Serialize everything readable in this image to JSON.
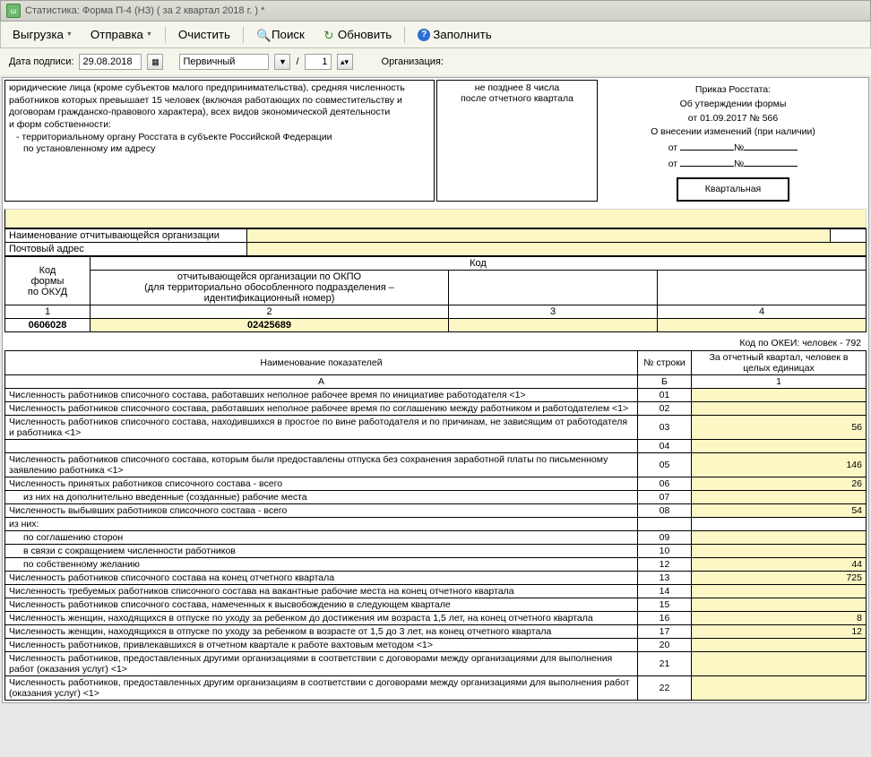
{
  "window": {
    "title": "Статистика: Форма П-4 (НЗ) ( за 2 квартал 2018 г. ) *"
  },
  "toolbar": {
    "export": "Выгрузка",
    "send": "Отправка",
    "clear": "Очистить",
    "search": "Поиск",
    "refresh": "Обновить",
    "fill": "Заполнить"
  },
  "params": {
    "date_label": "Дата подписи:",
    "date_value": "29.08.2018",
    "type_value": "Первичный",
    "slash": "/",
    "num_value": "1",
    "org_label": "Организация:"
  },
  "header": {
    "left_l1": "юридические лица (кроме субъектов малого предпринимательства), средняя численность",
    "left_l2": "работников которых превышает 15 человек (включая работающих по совместительству и",
    "left_l3": "договорам гражданско-правового характера), всех видов экономической деятельности",
    "left_l4": "и форм собственности:",
    "left_l5": "- территориальному органу Росстата в субъекте Российской Федерации",
    "left_l6": "по установленному им адресу",
    "mid_l1": "не позднее 8 числа",
    "mid_l2": "после отчетного квартала",
    "right_l1": "Приказ Росстата:",
    "right_l2": "Об утверждении формы",
    "right_l3": "от 01.09.2017 № 566",
    "right_l4": "О внесении изменений (при наличии)",
    "right_ot": "от",
    "right_no": "№",
    "badge": "Квартальная"
  },
  "org": {
    "name_label": "Наименование отчитывающейся организации",
    "addr_label": "Почтовый адрес"
  },
  "codes": {
    "col1_l1": "Код",
    "col1_l2": "формы",
    "col1_l3": "по ОКУД",
    "col_code": "Код",
    "col2_l1": "отчитывающейся организации по ОКПО",
    "col2_l2": "(для территориально обособленного подразделения –",
    "col2_l3": "идентификационный номер)",
    "h1": "1",
    "h2": "2",
    "h3": "3",
    "h4": "4",
    "v1": "0606028",
    "v2": "02425689"
  },
  "note": "Код по ОКЕИ: человек - 792",
  "dtable": {
    "col_a": "Наименование показателей",
    "col_b": "№ строки",
    "col_1": "За отчетный квартал, человек в целых единицах",
    "ha": "А",
    "hb": "Б",
    "h1": "1",
    "rows": [
      {
        "name": "Численность работников списочного состава, работавших неполное рабочее время по инициативе работодателя <1>",
        "num": "01",
        "val": ""
      },
      {
        "name": "Численность работников списочного состава, работавших неполное рабочее время по соглашению между работником и работодателем <1>",
        "num": "02",
        "val": ""
      },
      {
        "name": "Численность работников списочного состава, находившихся в простое по вине работодателя и по причинам, не зависящим от работодателя и работника <1>",
        "num": "03",
        "val": "56"
      },
      {
        "name": "",
        "num": "04",
        "val": ""
      },
      {
        "name": "Численность работников списочного состава, которым были предоставлены отпуска без сохранения заработной платы по письменному заявлению работника <1>",
        "num": "05",
        "val": "146"
      },
      {
        "name": "Численность принятых работников списочного состава - всего",
        "num": "06",
        "val": "26"
      },
      {
        "name": "из них на дополнительно введенные (созданные) рабочие места",
        "num": "07",
        "val": "",
        "ind": "ind2"
      },
      {
        "name": "Численность выбывших работников списочного состава - всего",
        "num": "08",
        "val": "54"
      },
      {
        "name": "из них:",
        "num": "",
        "val": "",
        "noval": true
      },
      {
        "name": "по соглашению сторон",
        "num": "09",
        "val": "",
        "ind": "ind2"
      },
      {
        "name": "в связи с сокращением численности работников",
        "num": "10",
        "val": "",
        "ind": "ind2"
      },
      {
        "name": "по собственному желанию",
        "num": "12",
        "val": "44",
        "ind": "ind2"
      },
      {
        "name": "Численность работников списочного состава на конец отчетного квартала",
        "num": "13",
        "val": "725"
      },
      {
        "name": "Численность требуемых работников списочного состава на вакантные рабочие места на конец отчетного квартала",
        "num": "14",
        "val": ""
      },
      {
        "name": "Численность работников списочного состава, намеченных к высвобождению в следующем квартале",
        "num": "15",
        "val": ""
      },
      {
        "name": "Численность женщин, находящихся в отпуске по уходу за ребенком до достижения им возраста 1,5 лет, на конец отчетного квартала",
        "num": "16",
        "val": "8"
      },
      {
        "name": "Численность женщин, находящихся в отпуске по уходу за ребенком в возрасте от 1,5 до 3 лет, на конец отчетного квартала",
        "num": "17",
        "val": "12"
      },
      {
        "name": "Численность работников, привлекавшихся в отчетном квартале к работе вахтовым методом <1>",
        "num": "20",
        "val": ""
      },
      {
        "name": "Численность работников, предоставленных другими организациями в соответствии с договорами между организациями для выполнения работ (оказания услуг) <1>",
        "num": "21",
        "val": ""
      },
      {
        "name": "Численность работников, предоставленных другим организациям в соответствии с договорами между организациями для выполнения работ (оказания услуг) <1>",
        "num": "22",
        "val": ""
      }
    ]
  }
}
